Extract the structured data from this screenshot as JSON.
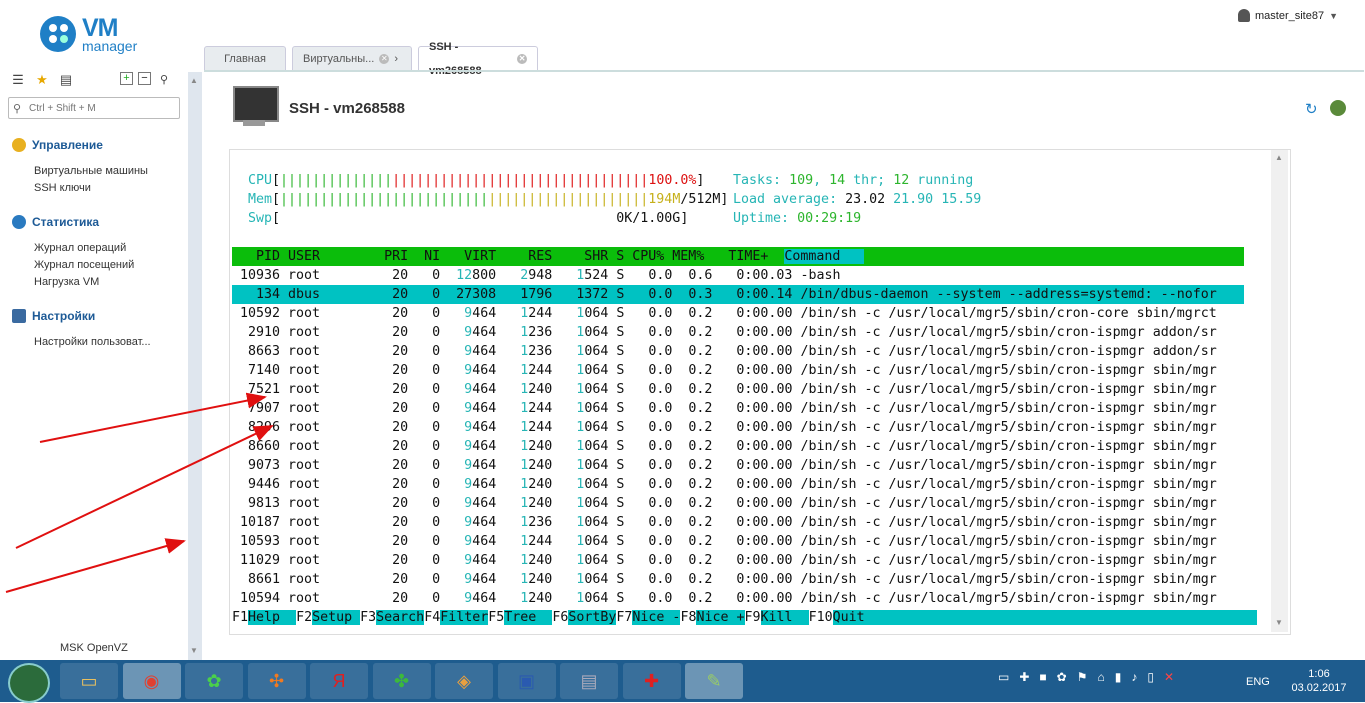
{
  "app": {
    "logo_vm": "VM",
    "logo_manager": "manager",
    "user_name": "master_site87"
  },
  "sidebar": {
    "search_placeholder": "Ctrl + Shift + M",
    "sections": [
      {
        "title": "Управление",
        "items": [
          "Виртуальные машины",
          "SSH ключи"
        ]
      },
      {
        "title": "Статистика",
        "items": [
          "Журнал операций",
          "Журнал посещений",
          "Нагрузка VM"
        ]
      },
      {
        "title": "Настройки",
        "items": [
          "Настройки пользоват..."
        ]
      }
    ],
    "footer": "MSK OpenVZ"
  },
  "tabs": [
    {
      "label": "Главная"
    },
    {
      "label": "Виртуальны..."
    },
    {
      "label": "SSH - vm268588"
    }
  ],
  "page": {
    "title": "SSH - vm268588"
  },
  "terminal": {
    "cpu_label": "CPU",
    "cpu_value": "100.0%",
    "mem_label": "Mem",
    "mem_used": "194M",
    "mem_total": "512M",
    "swp_label": "Swp",
    "swp_value": "0K/1.00G",
    "tasks_label": "Tasks:",
    "tasks": "109",
    "threads": "14",
    "threads_label": "thr;",
    "running": "12",
    "running_label": "running",
    "load_label": "Load average:",
    "load1": "23.02",
    "load5": "21.90",
    "load15": "15.59",
    "uptime_label": "Uptime:",
    "uptime": "00:29:19",
    "columns": [
      "PID",
      "USER",
      "PRI",
      "NI",
      "VIRT",
      "RES",
      "SHR",
      "S",
      "CPU%",
      "MEM%",
      "TIME+",
      "Command"
    ],
    "processes": [
      {
        "pid": "10936",
        "user": "root",
        "pri": "20",
        "ni": "0",
        "virt": "12800",
        "res": "2948",
        "shr": "1524",
        "s": "S",
        "cpu": "0.0",
        "mem": "0.6",
        "time": "0:00.03",
        "cmd": "-bash"
      },
      {
        "pid": "134",
        "user": "dbus",
        "pri": "20",
        "ni": "0",
        "virt": "27308",
        "res": "1796",
        "shr": "1372",
        "s": "S",
        "cpu": "0.0",
        "mem": "0.3",
        "time": "0:00.14",
        "cmd": "/bin/dbus-daemon --system --address=systemd: --nofor"
      },
      {
        "pid": "10592",
        "user": "root",
        "pri": "20",
        "ni": "0",
        "virt": "9464",
        "res": "1244",
        "shr": "1064",
        "s": "S",
        "cpu": "0.0",
        "mem": "0.2",
        "time": "0:00.00",
        "cmd": "/bin/sh -c /usr/local/mgr5/sbin/cron-core sbin/mgrct"
      },
      {
        "pid": "2910",
        "user": "root",
        "pri": "20",
        "ni": "0",
        "virt": "9464",
        "res": "1236",
        "shr": "1064",
        "s": "S",
        "cpu": "0.0",
        "mem": "0.2",
        "time": "0:00.00",
        "cmd": "/bin/sh -c /usr/local/mgr5/sbin/cron-ispmgr addon/sr"
      },
      {
        "pid": "8663",
        "user": "root",
        "pri": "20",
        "ni": "0",
        "virt": "9464",
        "res": "1236",
        "shr": "1064",
        "s": "S",
        "cpu": "0.0",
        "mem": "0.2",
        "time": "0:00.00",
        "cmd": "/bin/sh -c /usr/local/mgr5/sbin/cron-ispmgr addon/sr"
      },
      {
        "pid": "7140",
        "user": "root",
        "pri": "20",
        "ni": "0",
        "virt": "9464",
        "res": "1244",
        "shr": "1064",
        "s": "S",
        "cpu": "0.0",
        "mem": "0.2",
        "time": "0:00.00",
        "cmd": "/bin/sh -c /usr/local/mgr5/sbin/cron-ispmgr sbin/mgr"
      },
      {
        "pid": "7521",
        "user": "root",
        "pri": "20",
        "ni": "0",
        "virt": "9464",
        "res": "1240",
        "shr": "1064",
        "s": "S",
        "cpu": "0.0",
        "mem": "0.2",
        "time": "0:00.00",
        "cmd": "/bin/sh -c /usr/local/mgr5/sbin/cron-ispmgr sbin/mgr"
      },
      {
        "pid": "7907",
        "user": "root",
        "pri": "20",
        "ni": "0",
        "virt": "9464",
        "res": "1244",
        "shr": "1064",
        "s": "S",
        "cpu": "0.0",
        "mem": "0.2",
        "time": "0:00.00",
        "cmd": "/bin/sh -c /usr/local/mgr5/sbin/cron-ispmgr sbin/mgr"
      },
      {
        "pid": "8296",
        "user": "root",
        "pri": "20",
        "ni": "0",
        "virt": "9464",
        "res": "1244",
        "shr": "1064",
        "s": "S",
        "cpu": "0.0",
        "mem": "0.2",
        "time": "0:00.00",
        "cmd": "/bin/sh -c /usr/local/mgr5/sbin/cron-ispmgr sbin/mgr"
      },
      {
        "pid": "8660",
        "user": "root",
        "pri": "20",
        "ni": "0",
        "virt": "9464",
        "res": "1240",
        "shr": "1064",
        "s": "S",
        "cpu": "0.0",
        "mem": "0.2",
        "time": "0:00.00",
        "cmd": "/bin/sh -c /usr/local/mgr5/sbin/cron-ispmgr sbin/mgr"
      },
      {
        "pid": "9073",
        "user": "root",
        "pri": "20",
        "ni": "0",
        "virt": "9464",
        "res": "1240",
        "shr": "1064",
        "s": "S",
        "cpu": "0.0",
        "mem": "0.2",
        "time": "0:00.00",
        "cmd": "/bin/sh -c /usr/local/mgr5/sbin/cron-ispmgr sbin/mgr"
      },
      {
        "pid": "9446",
        "user": "root",
        "pri": "20",
        "ni": "0",
        "virt": "9464",
        "res": "1240",
        "shr": "1064",
        "s": "S",
        "cpu": "0.0",
        "mem": "0.2",
        "time": "0:00.00",
        "cmd": "/bin/sh -c /usr/local/mgr5/sbin/cron-ispmgr sbin/mgr"
      },
      {
        "pid": "9813",
        "user": "root",
        "pri": "20",
        "ni": "0",
        "virt": "9464",
        "res": "1240",
        "shr": "1064",
        "s": "S",
        "cpu": "0.0",
        "mem": "0.2",
        "time": "0:00.00",
        "cmd": "/bin/sh -c /usr/local/mgr5/sbin/cron-ispmgr sbin/mgr"
      },
      {
        "pid": "10187",
        "user": "root",
        "pri": "20",
        "ni": "0",
        "virt": "9464",
        "res": "1236",
        "shr": "1064",
        "s": "S",
        "cpu": "0.0",
        "mem": "0.2",
        "time": "0:00.00",
        "cmd": "/bin/sh -c /usr/local/mgr5/sbin/cron-ispmgr sbin/mgr"
      },
      {
        "pid": "10593",
        "user": "root",
        "pri": "20",
        "ni": "0",
        "virt": "9464",
        "res": "1244",
        "shr": "1064",
        "s": "S",
        "cpu": "0.0",
        "mem": "0.2",
        "time": "0:00.00",
        "cmd": "/bin/sh -c /usr/local/mgr5/sbin/cron-ispmgr sbin/mgr"
      },
      {
        "pid": "11029",
        "user": "root",
        "pri": "20",
        "ni": "0",
        "virt": "9464",
        "res": "1240",
        "shr": "1064",
        "s": "S",
        "cpu": "0.0",
        "mem": "0.2",
        "time": "0:00.00",
        "cmd": "/bin/sh -c /usr/local/mgr5/sbin/cron-ispmgr sbin/mgr"
      },
      {
        "pid": "8661",
        "user": "root",
        "pri": "20",
        "ni": "0",
        "virt": "9464",
        "res": "1240",
        "shr": "1064",
        "s": "S",
        "cpu": "0.0",
        "mem": "0.2",
        "time": "0:00.00",
        "cmd": "/bin/sh -c /usr/local/mgr5/sbin/cron-ispmgr sbin/mgr"
      },
      {
        "pid": "10594",
        "user": "root",
        "pri": "20",
        "ni": "0",
        "virt": "9464",
        "res": "1240",
        "shr": "1064",
        "s": "S",
        "cpu": "0.0",
        "mem": "0.2",
        "time": "0:00.00",
        "cmd": "/bin/sh -c /usr/local/mgr5/sbin/cron-ispmgr sbin/mgr"
      }
    ],
    "fkeys": [
      {
        "key": "F1",
        "label": "Help  "
      },
      {
        "key": "F2",
        "label": "Setup "
      },
      {
        "key": "F3",
        "label": "Search"
      },
      {
        "key": "F4",
        "label": "Filter"
      },
      {
        "key": "F5",
        "label": "Tree  "
      },
      {
        "key": "F6",
        "label": "SortBy"
      },
      {
        "key": "F7",
        "label": "Nice -"
      },
      {
        "key": "F8",
        "label": "Nice +"
      },
      {
        "key": "F9",
        "label": "Kill  "
      },
      {
        "key": "F10",
        "label": "Quit"
      }
    ]
  },
  "taskbar": {
    "lang": "ENG",
    "time": "1:06",
    "date": "03.02.2017",
    "apps": [
      "folder-icon",
      "chrome-icon",
      "icq-icon",
      "clover-icon",
      "yandex-icon",
      "leaf-icon",
      "eye-icon",
      "floppy-icon",
      "monitor-icon",
      "aid-icon",
      "notepad-icon"
    ]
  },
  "colors": {
    "accent": "#1f7fc6",
    "htop_header": "#0bbd0b",
    "htop_selected": "#00c2c2",
    "htop_teal": "#26b5b5",
    "arrow": "#e01010"
  }
}
